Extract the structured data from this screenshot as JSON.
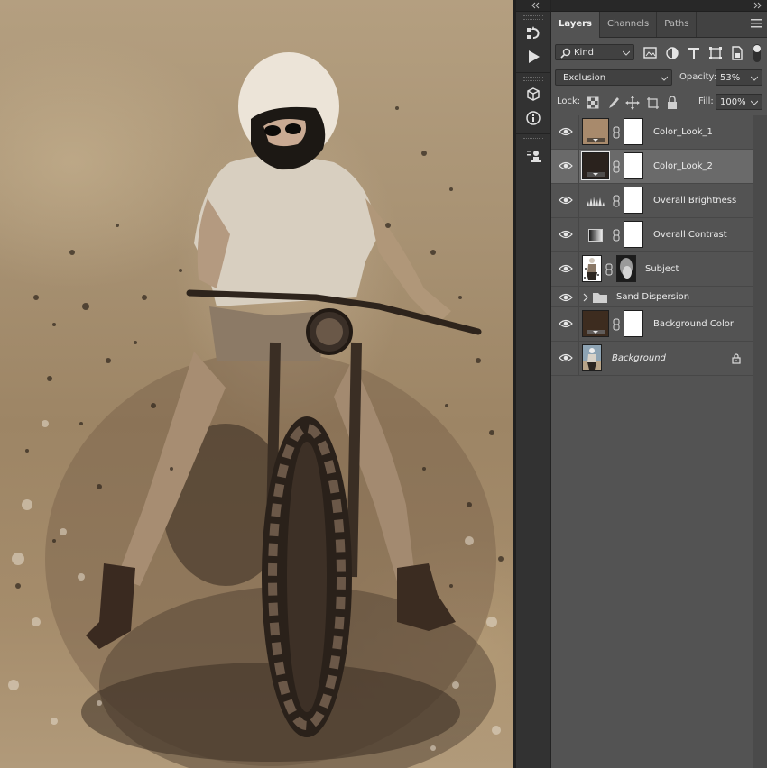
{
  "panel": {
    "tabs": [
      "Layers",
      "Channels",
      "Paths"
    ],
    "filter_kind": "Kind",
    "blend_mode": "Exclusion",
    "opacity_label": "Opacity:",
    "opacity_value": "53%",
    "lock_label": "Lock:",
    "fill_label": "Fill:",
    "fill_value": "100%"
  },
  "layers": [
    {
      "name": "Color_Look_1",
      "thumb_color": "#a88a6c",
      "type": "solid-fill",
      "selected": false
    },
    {
      "name": "Color_Look_2",
      "thumb_color": "#2a221d",
      "type": "solid-fill",
      "selected": true
    },
    {
      "name": "Overall Brightness",
      "type": "levels",
      "selected": false
    },
    {
      "name": "Overall Contrast",
      "type": "gradient-map",
      "selected": false
    },
    {
      "name": "Subject",
      "type": "pixel-with-mask",
      "selected": false
    },
    {
      "name": "Sand Dispersion",
      "type": "group",
      "selected": false
    },
    {
      "name": "Background Color",
      "thumb_color": "#3d2c1f",
      "type": "solid-fill",
      "selected": false
    },
    {
      "name": "Background",
      "type": "background",
      "locked": true,
      "selected": false
    }
  ],
  "colors": {
    "panel_bg": "#535353",
    "selected_row": "#6a6a6a",
    "canvas_tone": "#a48b6b"
  },
  "icons": {
    "tool_strip": [
      "history-icon",
      "actions-play-icon",
      "3d-cube-icon",
      "info-icon",
      "clone-source-icon"
    ],
    "filter": [
      "image-filter-icon",
      "adjustment-filter-icon",
      "type-filter-icon",
      "shape-filter-icon",
      "smart-object-filter-icon",
      "filter-toggle-icon"
    ],
    "lock": [
      "lock-transparent-icon",
      "lock-image-icon",
      "lock-position-icon",
      "lock-artboard-icon",
      "lock-all-icon"
    ]
  }
}
